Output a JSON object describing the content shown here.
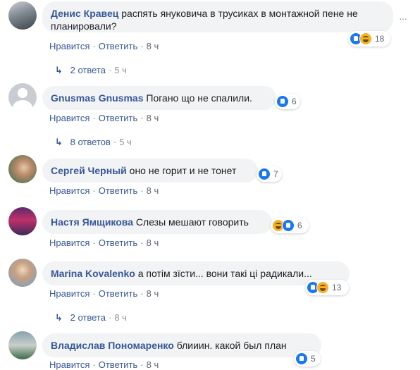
{
  "actions": {
    "like": "Нравится",
    "reply": "Ответить",
    "dot": "·"
  },
  "more_icon": "···",
  "comments": [
    {
      "author": "Денис Кравец",
      "text": "распять януковича в трусиках в монтажной пене не планировали?",
      "time": "8 ч",
      "reactions": [
        "like",
        "haha"
      ],
      "reaction_count": "18",
      "replies": "2 ответа",
      "replies_time": "5 ч"
    },
    {
      "author": "Gnusmas Gnusmas",
      "text": "Погано що не спалили.",
      "time": "8 ч",
      "reactions": [
        "like"
      ],
      "reaction_count": "6",
      "replies": "8 ответов",
      "replies_time": "5 ч"
    },
    {
      "author": "Сергей Черный",
      "text": "оно не горит и не тонет",
      "time": "8 ч",
      "reactions": [
        "like"
      ],
      "reaction_count": "7"
    },
    {
      "author": "Настя Ямщикова",
      "text": "Слезы мешают говорить",
      "time": "8 ч",
      "reactions": [
        "haha",
        "like"
      ],
      "reaction_count": "6"
    },
    {
      "author": "Marina Kovalenko",
      "text": "а потім зїсти... вони такі ці радикали...",
      "time": "8 ч",
      "reactions": [
        "like",
        "haha"
      ],
      "reaction_count": "13",
      "replies": "2 ответа",
      "replies_time": "8 ч"
    },
    {
      "author": "Владислав Пономаренко",
      "text": "блииин. какой был план",
      "time": "8 ч",
      "reactions": [
        "like"
      ],
      "reaction_count": "5"
    }
  ]
}
